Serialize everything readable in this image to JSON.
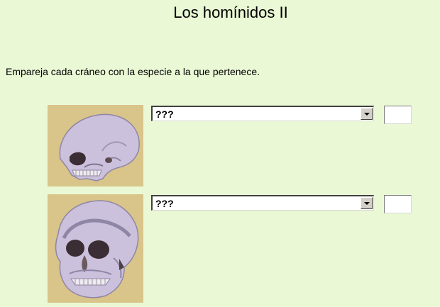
{
  "page": {
    "title": "Los homínidos II",
    "instructions": "Empareja cada cráneo con la especie a la que pertenece."
  },
  "questions": [
    {
      "image_icon": "skull-side-view",
      "select_value": "???",
      "answer_value": ""
    },
    {
      "image_icon": "skull-front-three-quarter-view",
      "select_value": "???",
      "answer_value": ""
    }
  ],
  "colors": {
    "background": "#eaf8d5",
    "image_background": "#d9c489",
    "skull": "#c9bfd9"
  }
}
